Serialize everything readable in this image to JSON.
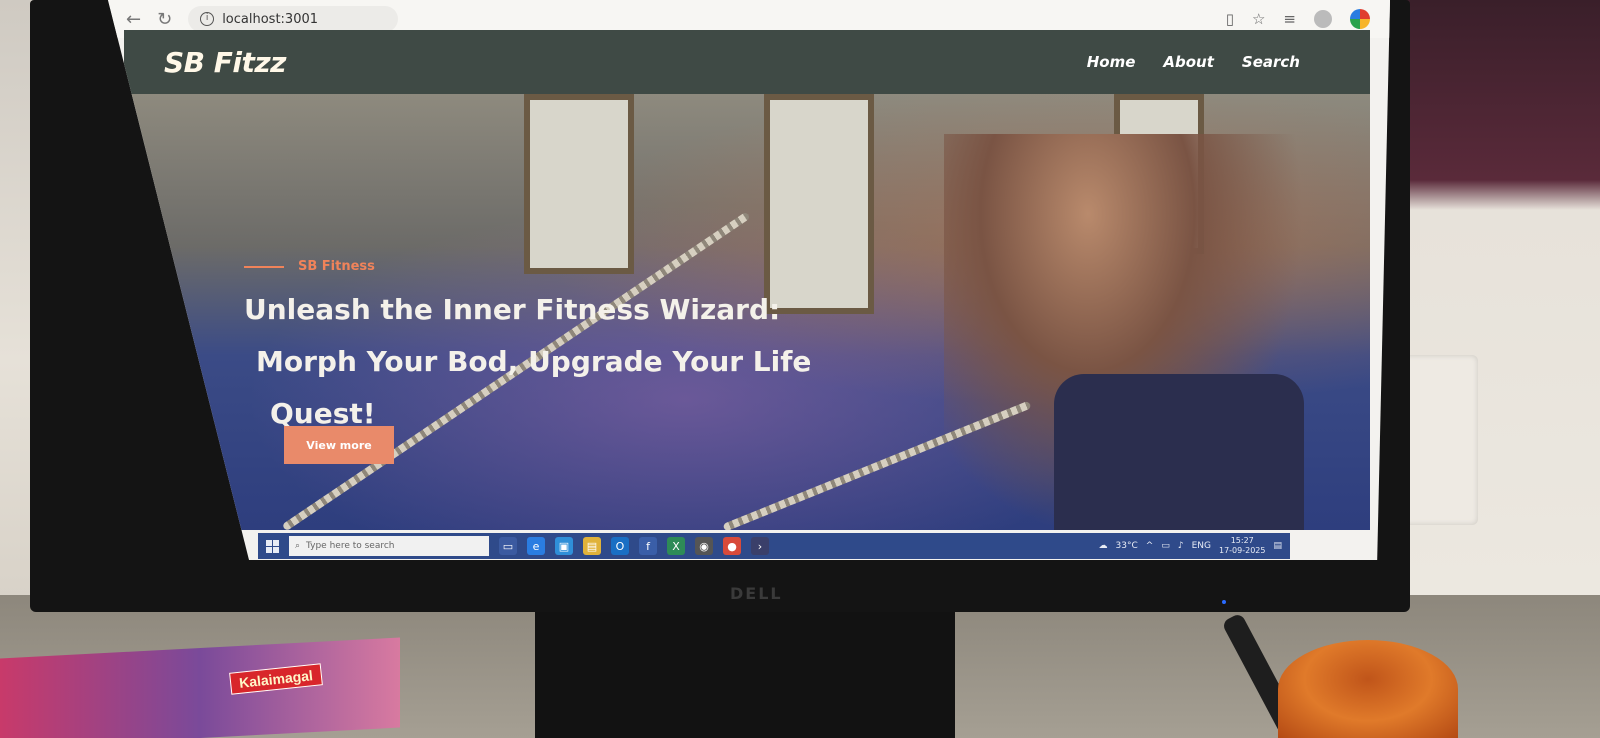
{
  "browser": {
    "url": "localhost:3001",
    "back_icon": "arrow-left-icon",
    "reload_icon": "reload-icon"
  },
  "site": {
    "brand": "SB Fitzz",
    "nav": [
      {
        "label": "Home"
      },
      {
        "label": "About"
      },
      {
        "label": "Search"
      }
    ],
    "hero": {
      "tag": "SB Fitness",
      "title_line1": "Unleash the Inner Fitness Wizard:",
      "title_line2": "Morph Your Bod, Upgrade Your Life",
      "title_line3": "Quest!",
      "cta": "View more"
    },
    "colors": {
      "navbar": "#3f4a45",
      "accent": "#f0835a",
      "cta": "#e98a6a"
    }
  },
  "taskbar": {
    "search_placeholder": "Type here to search",
    "temperature": "33°C",
    "language": "ENG",
    "time": "15:27",
    "date": "17-09-2025"
  },
  "environment": {
    "monitor_brand": "DELL",
    "book_label": "Kalaimagal"
  }
}
